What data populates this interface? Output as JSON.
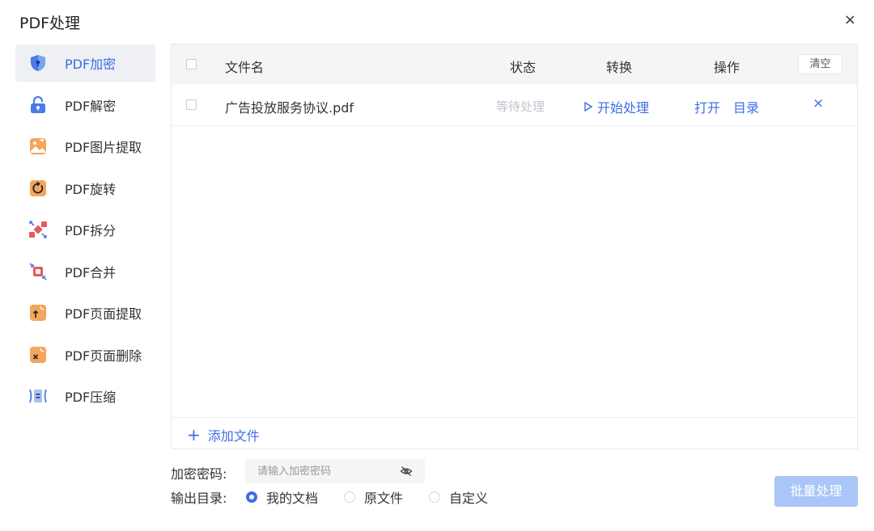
{
  "window": {
    "title": "PDF处理",
    "close_label": "×"
  },
  "sidebar": {
    "items": [
      {
        "label": "PDF加密",
        "icon": "shield-lock-icon",
        "active": true
      },
      {
        "label": "PDF解密",
        "icon": "unlock-icon"
      },
      {
        "label": "PDF图片提取",
        "icon": "image-extract-icon"
      },
      {
        "label": "PDF旋转",
        "icon": "rotate-icon"
      },
      {
        "label": "PDF拆分",
        "icon": "split-icon"
      },
      {
        "label": "PDF合并",
        "icon": "merge-icon"
      },
      {
        "label": "PDF页面提取",
        "icon": "page-extract-icon"
      },
      {
        "label": "PDF页面删除",
        "icon": "page-delete-icon"
      },
      {
        "label": "PDF压缩",
        "icon": "compress-icon"
      }
    ]
  },
  "table": {
    "headers": {
      "filename": "文件名",
      "status": "状态",
      "convert": "转换",
      "actions": "操作"
    },
    "clear_label": "清空",
    "rows": [
      {
        "filename": "广告投放服务协议.pdf",
        "status": "等待处理",
        "convert": "开始处理",
        "open": "打开",
        "directory": "目录",
        "delete": "×"
      }
    ],
    "add_file_label": "添加文件",
    "add_file_icon": "+"
  },
  "options": {
    "password_label": "加密密码:",
    "password_value": "",
    "password_placeholder": "请输入加密密码",
    "output_label": "输出目录:",
    "output_options": [
      {
        "label": "我的文档",
        "checked": true
      },
      {
        "label": "原文件",
        "checked": false
      },
      {
        "label": "自定义",
        "checked": false
      }
    ]
  },
  "batch_button": "批量处理",
  "colors": {
    "accent": "#3b6ee6",
    "disabled_button": "#a9c6f7",
    "header_bg": "#f4f5f7"
  }
}
